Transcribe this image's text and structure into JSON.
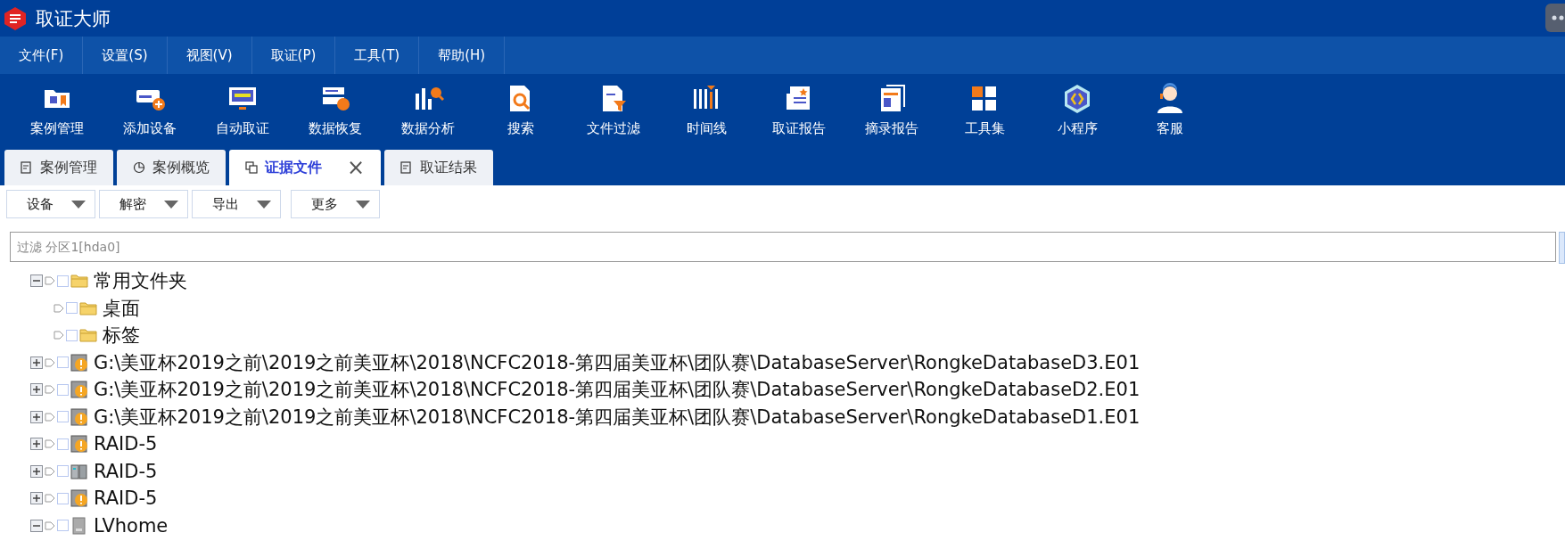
{
  "window": {
    "title": "取证大师"
  },
  "menu": [
    "文件(F)",
    "设置(S)",
    "视图(V)",
    "取证(P)",
    "工具(T)",
    "帮助(H)"
  ],
  "toolbar": [
    "案例管理",
    "添加设备",
    "自动取证",
    "数据恢复",
    "数据分析",
    "搜索",
    "文件过滤",
    "时间线",
    "取证报告",
    "摘录报告",
    "工具集",
    "小程序",
    "客服"
  ],
  "tabs": [
    {
      "label": "案例管理",
      "selected": false
    },
    {
      "label": "案例概览",
      "selected": false
    },
    {
      "label": "证据文件",
      "selected": true,
      "close": "×"
    },
    {
      "label": "取证结果",
      "selected": false
    }
  ],
  "actions": [
    "设备",
    "解密",
    "导出",
    "更多"
  ],
  "filter": {
    "placeholder": "过滤 分区1[hda0]"
  },
  "tree": [
    {
      "label": "常用文件夹",
      "kind": "folder",
      "checked": false,
      "expanded": true,
      "children": [
        {
          "label": "桌面",
          "kind": "folder",
          "checked": false
        },
        {
          "label": "标签",
          "kind": "folder",
          "checked": false
        }
      ]
    },
    {
      "label": "G:\\美亚杯2019之前\\2019之前美亚杯\\2018\\NCFC2018-第四届美亚杯\\团队赛\\DatabaseServer\\RongkeDatabaseD3.E01",
      "kind": "warning",
      "checked": false,
      "expanded": false
    },
    {
      "label": "G:\\美亚杯2019之前\\2019之前美亚杯\\2018\\NCFC2018-第四届美亚杯\\团队赛\\DatabaseServer\\RongkeDatabaseD2.E01",
      "kind": "warning",
      "checked": false,
      "expanded": false
    },
    {
      "label": "G:\\美亚杯2019之前\\2019之前美亚杯\\2018\\NCFC2018-第四届美亚杯\\团队赛\\DatabaseServer\\RongkeDatabaseD1.E01",
      "kind": "warning",
      "checked": false,
      "expanded": false
    },
    {
      "label": "RAID-5",
      "kind": "warning",
      "checked": false,
      "expanded": false
    },
    {
      "label": "RAID-5",
      "kind": "raid",
      "checked": false,
      "expanded": false
    },
    {
      "label": "RAID-5",
      "kind": "warning",
      "checked": false,
      "expanded": false
    },
    {
      "label": "LVhome",
      "kind": "disk",
      "checked": false,
      "expanded": true
    }
  ]
}
